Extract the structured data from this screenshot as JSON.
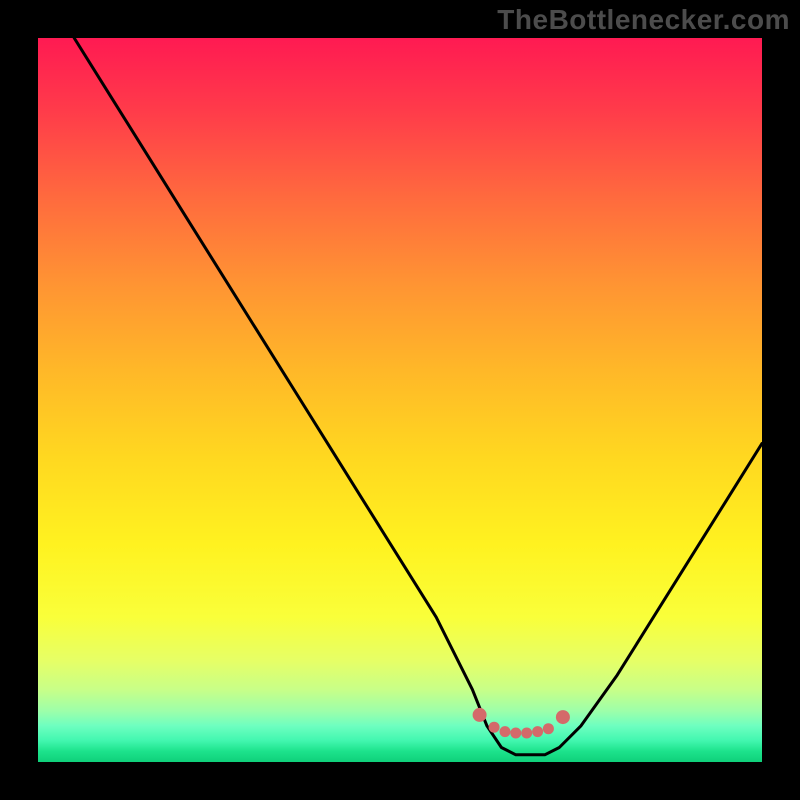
{
  "watermark": "TheBottlenecker.com",
  "chart_data": {
    "type": "line",
    "title": "",
    "xlabel": "",
    "ylabel": "",
    "xlim": [
      0,
      100
    ],
    "ylim": [
      0,
      100
    ],
    "series": [
      {
        "name": "bottleneck-curve",
        "x": [
          5,
          10,
          15,
          20,
          25,
          30,
          35,
          40,
          45,
          50,
          55,
          60,
          62,
          64,
          66,
          68,
          70,
          72,
          75,
          80,
          85,
          90,
          95,
          100
        ],
        "values": [
          100,
          92,
          84,
          76,
          68,
          60,
          52,
          44,
          36,
          28,
          20,
          10,
          5,
          2,
          1,
          1,
          1,
          2,
          5,
          12,
          20,
          28,
          36,
          44
        ]
      }
    ],
    "markers": {
      "name": "highlight-dots",
      "color": "#d46a6a",
      "points_x": [
        61,
        63,
        64.5,
        66,
        67.5,
        69,
        70.5,
        72.5
      ],
      "points_y": [
        6.5,
        4.8,
        4.2,
        4.0,
        4.0,
        4.2,
        4.6,
        6.2
      ]
    },
    "background": {
      "type": "vertical-gradient",
      "stops": [
        {
          "pos": 0,
          "color": "#ff1a52"
        },
        {
          "pos": 50,
          "color": "#ffd020"
        },
        {
          "pos": 80,
          "color": "#f9ff3a"
        },
        {
          "pos": 100,
          "color": "#0fd07a"
        }
      ]
    }
  }
}
